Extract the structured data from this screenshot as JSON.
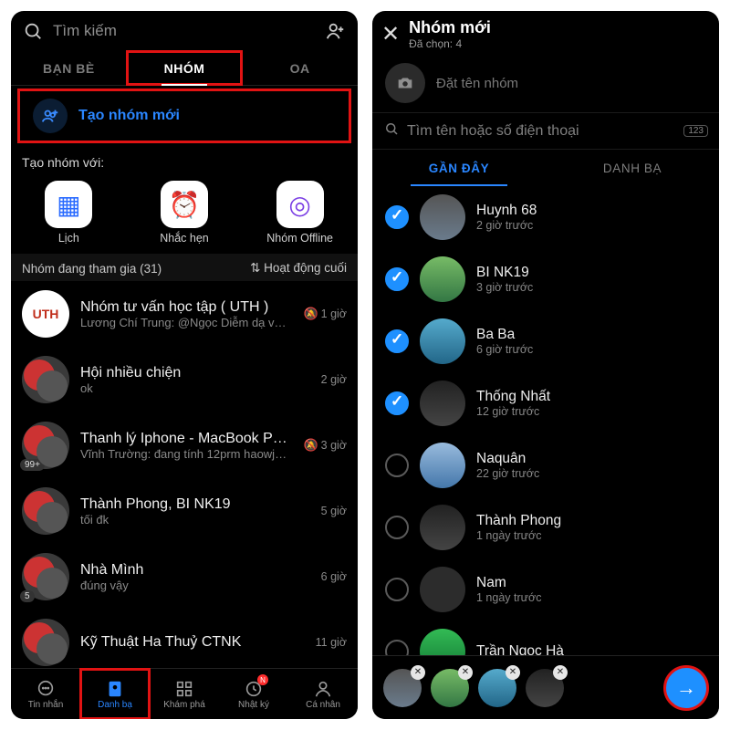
{
  "left": {
    "search_placeholder": "Tìm kiếm",
    "tabs": [
      "BẠN BÈ",
      "NHÓM",
      "OA"
    ],
    "create_label": "Tạo nhóm mới",
    "create_section_label": "Tạo nhóm với:",
    "quick": [
      {
        "label": "Lịch"
      },
      {
        "label": "Nhắc hẹn"
      },
      {
        "label": "Nhóm Offline"
      }
    ],
    "joined_label": "Nhóm đang tham gia (31)",
    "sort_label": "Hoạt động cuối",
    "groups": [
      {
        "title": "Nhóm tư vấn học tập ( UTH )",
        "sub": "Lương Chí Trung: @Ngọc Diễm dạ vâng ạ…",
        "time": "1 giờ",
        "muted": true,
        "avatar": "white",
        "avatar_text": "UTH"
      },
      {
        "title": "Hội nhiều chiện",
        "sub": "ok",
        "time": "2 giờ",
        "avatar": "duo"
      },
      {
        "title": "Thanh lý Iphone - MacBook P…",
        "sub": "Vĩnh Trường: đang tính 12prm haowjc 13…",
        "time": "3 giờ",
        "muted": true,
        "badge": "99+",
        "avatar": "duo"
      },
      {
        "title": "Thành Phong, BI NK19",
        "sub": "tối đk",
        "time": "5 giờ",
        "avatar": "duo"
      },
      {
        "title": "Nhà Mình",
        "sub": "đúng vậy",
        "time": "6 giờ",
        "badge": "5",
        "avatar": "duo"
      },
      {
        "title": "Kỹ Thuật Ha Thuỷ CTNK",
        "sub": "",
        "time": "11 giờ",
        "avatar": "duo"
      }
    ],
    "nav": [
      {
        "label": "Tin nhắn"
      },
      {
        "label": "Danh bạ",
        "active": true
      },
      {
        "label": "Khám phá"
      },
      {
        "label": "Nhật ký",
        "badge": "N"
      },
      {
        "label": "Cá nhân"
      }
    ]
  },
  "right": {
    "title": "Nhóm mới",
    "selected": "Đã chọn: 4",
    "name_placeholder": "Đặt tên nhóm",
    "search2_placeholder": "Tìm tên hoặc số điện thoại",
    "kbd_hint": "123",
    "tabs": [
      "GẦN ĐÂY",
      "DANH BẠ"
    ],
    "contacts": [
      {
        "name": "Huynh 68",
        "time": "2 giờ trước",
        "checked": true,
        "av": "a"
      },
      {
        "name": "BI NK19",
        "time": "3 giờ trước",
        "checked": true,
        "av": "b"
      },
      {
        "name": "Ba Ba",
        "time": "6 giờ trước",
        "checked": true,
        "av": "c"
      },
      {
        "name": "Thống Nhất",
        "time": "12 giờ trước",
        "checked": true,
        "av": "d"
      },
      {
        "name": "Naquân",
        "time": "22 giờ trước",
        "checked": false,
        "av": "e"
      },
      {
        "name": "Thành Phong",
        "time": "1 ngày trước",
        "checked": false,
        "av": "d"
      },
      {
        "name": "Nam",
        "time": "1 ngày trước",
        "checked": false,
        "av": "f"
      },
      {
        "name": "Trần Ngọc Hà",
        "time": "",
        "checked": false,
        "av": "g"
      }
    ]
  }
}
